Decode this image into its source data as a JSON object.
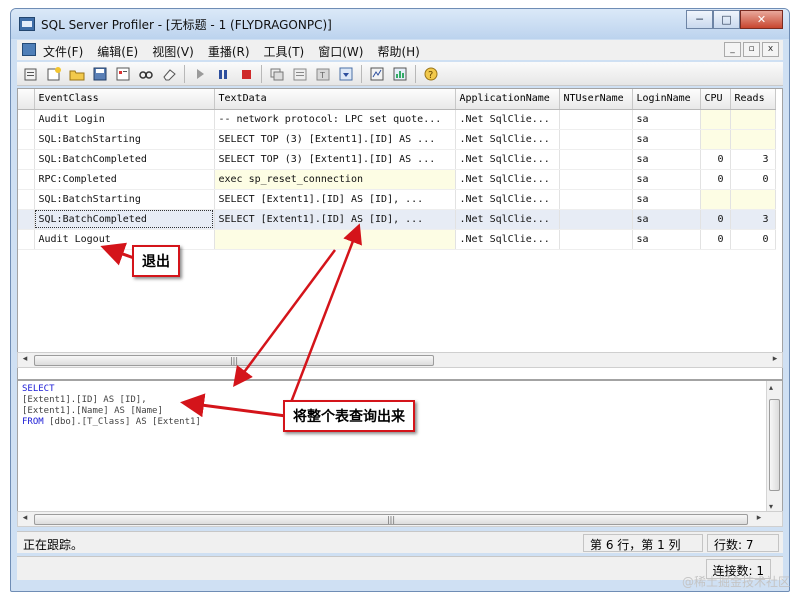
{
  "window": {
    "title": "SQL Server Profiler - [无标题 - 1 (FLYDRAGONPC)]",
    "controls": [
      "─",
      "□",
      "✕"
    ]
  },
  "menu": {
    "items": [
      "文件(F)",
      "编辑(E)",
      "视图(V)",
      "重播(R)",
      "工具(T)",
      "窗口(W)",
      "帮助(H)"
    ],
    "mdi_controls": [
      "_",
      "▫",
      "x"
    ]
  },
  "trace_grid": {
    "columns": [
      "EventClass",
      "TextData",
      "ApplicationName",
      "NTUserName",
      "LoginName",
      "CPU",
      "Reads"
    ],
    "rows": [
      {
        "event": "Audit Login",
        "text": "-- network protocol: LPC  set quote...",
        "app": ".Net SqlClie...",
        "nt": "",
        "login": "sa",
        "cpu": "",
        "reads": ""
      },
      {
        "event": "SQL:BatchStarting",
        "text": "SELECT TOP (3)   [Extent1].[ID] AS ...",
        "app": ".Net SqlClie...",
        "nt": "",
        "login": "sa",
        "cpu": "",
        "reads": ""
      },
      {
        "event": "SQL:BatchCompleted",
        "text": "SELECT TOP (3)   [Extent1].[ID] AS ...",
        "app": ".Net SqlClie...",
        "nt": "",
        "login": "sa",
        "cpu": "0",
        "reads": "3"
      },
      {
        "event": "RPC:Completed",
        "text": "exec sp_reset_connection",
        "app": ".Net SqlClie...",
        "nt": "",
        "login": "sa",
        "cpu": "0",
        "reads": "0"
      },
      {
        "event": "SQL:BatchStarting",
        "text": "SELECT   [Extent1].[ID] AS [ID],   ...",
        "app": ".Net SqlClie...",
        "nt": "",
        "login": "sa",
        "cpu": "",
        "reads": ""
      },
      {
        "event": "SQL:BatchCompleted",
        "text": "SELECT   [Extent1].[ID] AS [ID],   ...",
        "app": ".Net SqlClie...",
        "nt": "",
        "login": "sa",
        "cpu": "0",
        "reads": "3"
      },
      {
        "event": "Audit Logout",
        "text": "",
        "app": ".Net SqlClie...",
        "nt": "",
        "login": "sa",
        "cpu": "0",
        "reads": "0"
      }
    ],
    "selected_row": 6
  },
  "scrollbar": {
    "grip": "|||"
  },
  "sql_text": {
    "line1": "SELECT",
    "line2": "[Extent1].[ID] AS [ID],",
    "line3": "[Extent1].[Name] AS [Name]",
    "line4_kw": "FROM",
    "line4_rest": " [dbo].[T_Class] AS [Extent1]"
  },
  "status": {
    "tracing": "正在跟踪。",
    "position": "第 6 行，第 1 列",
    "row_count": "行数: 7",
    "connections": "连接数: 1"
  },
  "annotations": {
    "logout_callout": "退出",
    "query_callout": "将整个表查询出来",
    "arrow_color": "#d4141a"
  },
  "watermark": "@稀土掘金技术社区"
}
